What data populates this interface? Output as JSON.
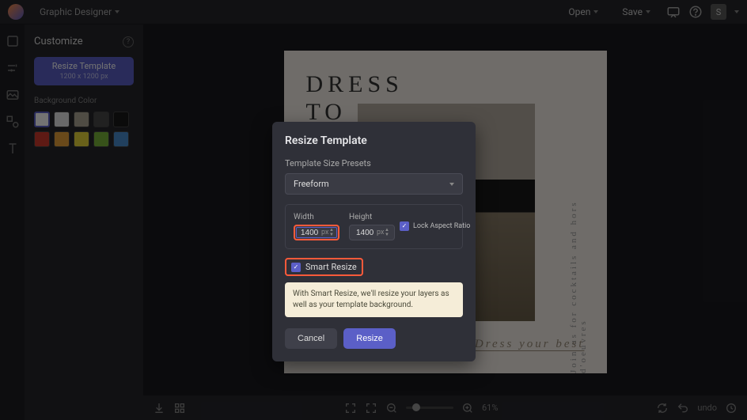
{
  "topbar": {
    "role": "Graphic Designer",
    "open": "Open",
    "save": "Save",
    "avatar": "S"
  },
  "sidepanel": {
    "title": "Customize",
    "resize_label": "Resize Template",
    "resize_dims": "1200 x 1200 px",
    "bg_label": "Background Color",
    "swatches": [
      [
        "#ffffff",
        "#e8e8e8",
        "#b0a898",
        "#4a4a4a",
        "#1a1a1a"
      ],
      [
        "#d13a2e",
        "#e8a23a",
        "#e8d83a",
        "#7ab53a",
        "#4a8fd1"
      ]
    ]
  },
  "canvas": {
    "headline_l1": "DRESS",
    "headline_l2": "TO",
    "vertical": "Join us for cocktails and hors d'oeuvres",
    "tagline": "Dress your best"
  },
  "bottombar": {
    "zoom": "61%",
    "undo": "undo"
  },
  "modal": {
    "title": "Resize Template",
    "presets_label": "Template Size Presets",
    "preset_value": "Freeform",
    "width_label": "Width",
    "width_value": "1400",
    "height_label": "Height",
    "height_value": "1400",
    "unit": "px",
    "lock_label": "Lock Aspect Ratio",
    "smart_label": "Smart Resize",
    "info": "With Smart Resize, we'll resize your layers as well as your template background.",
    "cancel": "Cancel",
    "resize": "Resize"
  }
}
